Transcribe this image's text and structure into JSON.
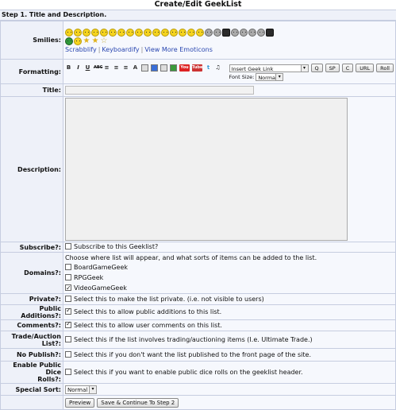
{
  "page": {
    "title": "Create/Edit GeekList"
  },
  "step": "Step 1. Title and Description.",
  "smilies": {
    "label": "Smilies:",
    "icons": [
      "smile-icon",
      "grin-icon",
      "wink-icon",
      "cool-icon",
      "surprised-icon",
      "sad-icon",
      "angry-icon",
      "tongue-icon",
      "laugh-icon",
      "cry-icon",
      "devil-icon",
      "embarrassed-icon",
      "thinking-icon",
      "confused-icon",
      "whistle-icon",
      "sleep-icon",
      "zombie-icon",
      "robot-icon",
      "geek-icon",
      "alien-icon",
      "ninja-icon",
      "pirate-icon",
      "ghost-icon",
      "skull-icon",
      "green-smile-icon",
      "yellow-smile-icon",
      "star-full-icon",
      "star-half-icon",
      "star-empty-icon"
    ],
    "links": [
      "Scrabblify",
      "Keyboardify",
      "View More Emoticons"
    ]
  },
  "formatting": {
    "label": "Formatting:",
    "icons": [
      "B",
      "I",
      "U",
      "ABC",
      "align-left",
      "align-center",
      "align-right",
      "font-color",
      "color-picker",
      "image",
      "video",
      "youtube",
      "link",
      "twitter",
      "music"
    ],
    "geek_link_select": "Insert Geek Link",
    "buttons": [
      "Q",
      "SP",
      "C",
      "URL",
      "Roll"
    ],
    "font_size_label": "Font Size:",
    "font_size_value": "Normal"
  },
  "title_field": {
    "label": "Title:",
    "value": ""
  },
  "description": {
    "label": "Description:",
    "value": ""
  },
  "subscribe": {
    "label": "Subscribe?:",
    "text": "Subscribe to this Geeklist?",
    "checked": false
  },
  "domains": {
    "label": "Domains?:",
    "note": "Choose where list will appear, and what sorts of items can be added to the list.",
    "items": [
      {
        "name": "BoardGameGeek",
        "checked": false
      },
      {
        "name": "RPGGeek",
        "checked": false
      },
      {
        "name": "VideoGameGeek",
        "checked": true
      }
    ]
  },
  "private": {
    "label": "Private?:",
    "text": "Select this to make the list private. (i.e. not visible to users)",
    "checked": false
  },
  "public_additions": {
    "label": "Public Additions?:",
    "text": "Select this to allow public additions to this list.",
    "checked": true
  },
  "comments": {
    "label": "Comments?:",
    "text": "Select this to allow user comments on this list.",
    "checked": true
  },
  "trade": {
    "label1": "Trade/Auction",
    "label2": "List?:",
    "text": "Select this if the list involves trading/auctioning items (I.e. Ultimate Trade.)",
    "checked": false
  },
  "no_publish": {
    "label": "No Publish?:",
    "text": "Select this if you don't want the list published to the front page of the site.",
    "checked": false
  },
  "dice": {
    "label1": "Enable Public Dice",
    "label2": "Rolls?:",
    "text": "Select this if you want to enable public dice rolls on the geeklist header.",
    "checked": false
  },
  "special_sort": {
    "label": "Special Sort:",
    "value": "Normal"
  },
  "actions": {
    "preview": "Preview",
    "save": "Save & Continue To Step 2"
  }
}
